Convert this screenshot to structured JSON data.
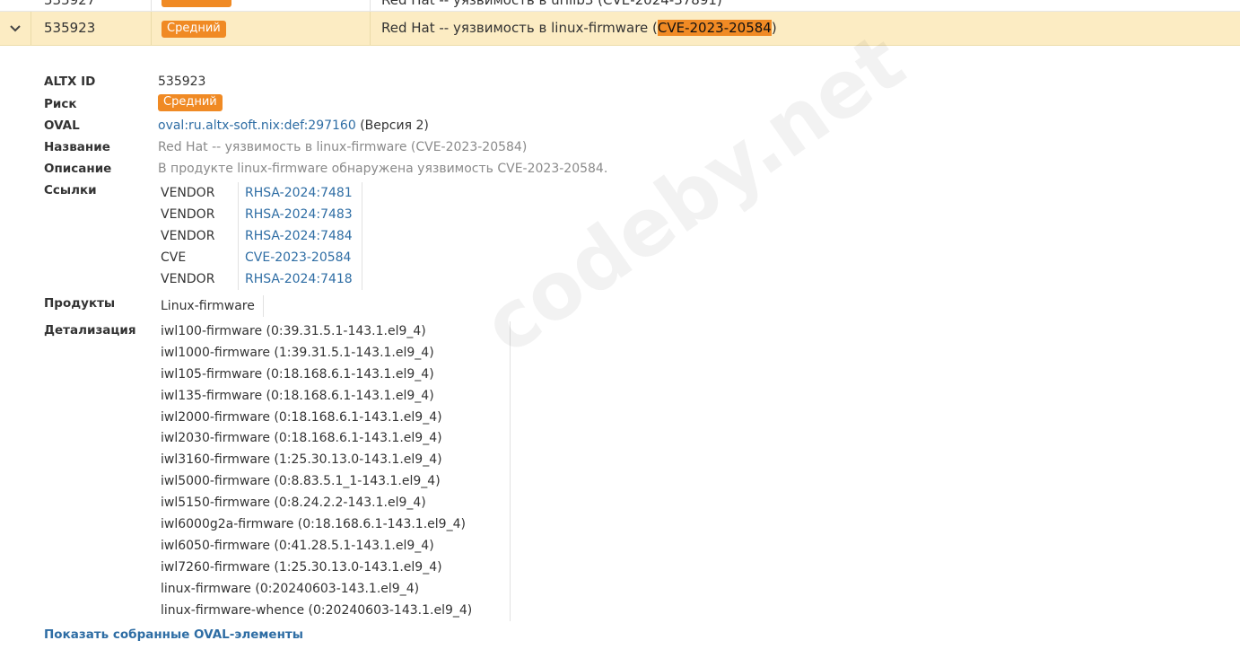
{
  "prev_row": {
    "id": "535927",
    "title": "Red Hat -- уязвимость в urllib3 (CVE-2024-37891)"
  },
  "selected_row": {
    "id": "535923",
    "risk": "Средний",
    "title_prefix": "Red Hat -- уязвимость в linux-firmware (",
    "title_cve": "CVE-2023-20584",
    "title_suffix": ")"
  },
  "details": {
    "altx_id_label": "ALTX ID",
    "altx_id": "535923",
    "risk_label": "Риск",
    "risk": "Средний",
    "oval_label": "OVAL",
    "oval_link": "oval:ru.altx-soft.nix:def:297160",
    "oval_version": "(Версия 2)",
    "name_label": "Название",
    "name": "Red Hat -- уязвимость в linux-firmware (CVE-2023-20584)",
    "description_label": "Описание",
    "description": "В продукте linux-firmware обнаружена уязвимость CVE-2023-20584.",
    "links_label": "Ссылки",
    "links": [
      {
        "source": "VENDOR",
        "ref": "RHSA-2024:7481"
      },
      {
        "source": "VENDOR",
        "ref": "RHSA-2024:7483"
      },
      {
        "source": "VENDOR",
        "ref": "RHSA-2024:7484"
      },
      {
        "source": "CVE",
        "ref": "CVE-2023-20584"
      },
      {
        "source": "VENDOR",
        "ref": "RHSA-2024:7418"
      }
    ],
    "products_label": "Продукты",
    "product": "Linux-firmware",
    "detail_label": "Детализация",
    "packages": [
      "iwl100-firmware (0:39.31.5.1-143.1.el9_4)",
      "iwl1000-firmware (1:39.31.5.1-143.1.el9_4)",
      "iwl105-firmware (0:18.168.6.1-143.1.el9_4)",
      "iwl135-firmware (0:18.168.6.1-143.1.el9_4)",
      "iwl2000-firmware (0:18.168.6.1-143.1.el9_4)",
      "iwl2030-firmware (0:18.168.6.1-143.1.el9_4)",
      "iwl3160-firmware (1:25.30.13.0-143.1.el9_4)",
      "iwl5000-firmware (0:8.83.5.1_1-143.1.el9_4)",
      "iwl5150-firmware (0:8.24.2.2-143.1.el9_4)",
      "iwl6000g2a-firmware (0:18.168.6.1-143.1.el9_4)",
      "iwl6050-firmware (0:41.28.5.1-143.1.el9_4)",
      "iwl7260-firmware (1:25.30.13.0-143.1.el9_4)",
      "linux-firmware (0:20240603-143.1.el9_4)",
      "linux-firmware-whence (0:20240603-143.1.el9_4)"
    ],
    "show_oval_link": "Показать собранные OVAL-элементы"
  },
  "watermark": "codeby.net",
  "colors": {
    "badge": "#f08a24",
    "selected_row_bg": "#fcecc3",
    "link": "#2e6da4"
  },
  "icons": {
    "expand": "chevron-down-icon"
  }
}
